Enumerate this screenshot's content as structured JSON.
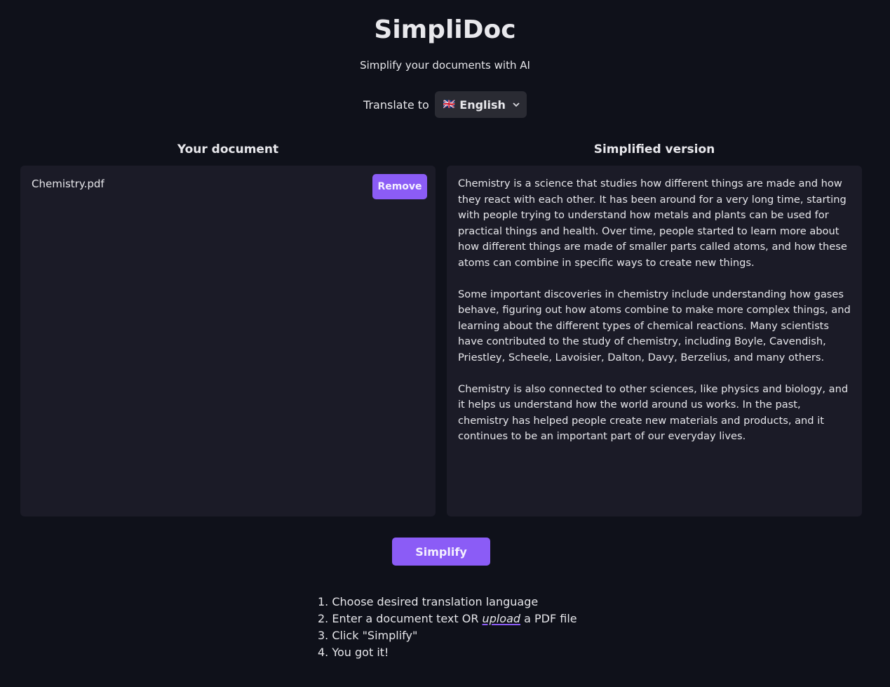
{
  "header": {
    "title": "SimpliDoc",
    "subtitle": "Simplify your documents with AI"
  },
  "translate": {
    "label": "Translate to",
    "selected_flag": "🇬🇧",
    "selected_language": "English"
  },
  "left_panel": {
    "heading": "Your document",
    "file_name": "Chemistry.pdf",
    "remove_label": "Remove"
  },
  "right_panel": {
    "heading": "Simplified version",
    "paragraphs": [
      "Chemistry is a science that studies how different things are made and how they react with each other. It has been around for a very long time, starting with people trying to understand how metals and plants can be used for practical things and health. Over time, people started to learn more about how different things are made of smaller parts called atoms, and how these atoms can combine in specific ways to create new things.",
      "Some important discoveries in chemistry include understanding how gases behave, figuring out how atoms combine to make more complex things, and learning about the different types of chemical reactions. Many scientists have contributed to the study of chemistry, including Boyle, Cavendish, Priestley, Scheele, Lavoisier, Dalton, Davy, Berzelius, and many others.",
      "Chemistry is also connected to other sciences, like physics and biology, and it helps us understand how the world around us works. In the past, chemistry has helped people create new materials and products, and it continues to be an important part of our everyday lives."
    ]
  },
  "simplify_label": "Simplify",
  "steps": {
    "step1": "1. Choose desired translation language",
    "step2_prefix": "2. Enter a document text OR ",
    "step2_link": "upload",
    "step2_suffix": " a PDF file",
    "step3": "3. Click \"Simplify\"",
    "step4": "4. You got it!"
  },
  "colors": {
    "background": "#0f111a",
    "panel": "#1b1b27",
    "accent": "#8b5cf6"
  }
}
